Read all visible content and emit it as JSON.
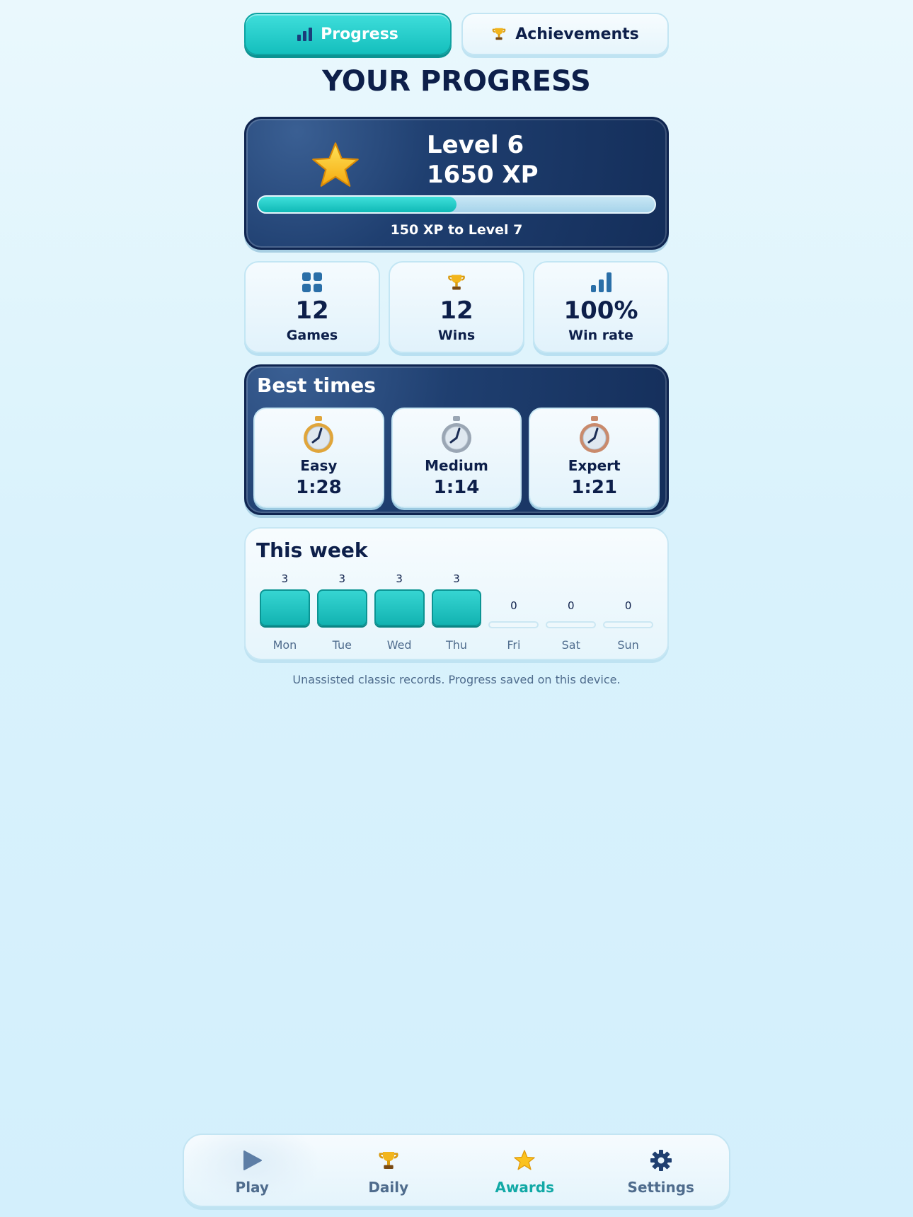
{
  "tabs": [
    {
      "label": "Progress",
      "icon": "bar-chart-icon",
      "active": true
    },
    {
      "label": "Achievements",
      "icon": "trophy-icon",
      "active": false
    }
  ],
  "page_title": "YOUR PROGRESS",
  "level": {
    "level_label": "Level 6",
    "xp_label": "1650 XP",
    "progress_fraction": 0.5,
    "next_label": "150 XP to Level 7"
  },
  "stats": [
    {
      "value": "12",
      "label": "Games",
      "icon": "grid-icon"
    },
    {
      "value": "12",
      "label": "Wins",
      "icon": "trophy-icon"
    },
    {
      "value": "100%",
      "label": "Win rate",
      "icon": "bar-chart-icon"
    }
  ],
  "best_times": {
    "title": "Best times",
    "items": [
      {
        "difficulty": "Easy",
        "time": "1:28",
        "medal_color": "#e0a53a"
      },
      {
        "difficulty": "Medium",
        "time": "1:14",
        "medal_color": "#9aa6b4"
      },
      {
        "difficulty": "Expert",
        "time": "1:21",
        "medal_color": "#c98a6c"
      }
    ]
  },
  "week": {
    "title": "This week",
    "days": [
      {
        "name": "Mon",
        "count": "3"
      },
      {
        "name": "Tue",
        "count": "3"
      },
      {
        "name": "Wed",
        "count": "3"
      },
      {
        "name": "Thu",
        "count": "3"
      },
      {
        "name": "Fri",
        "count": "0"
      },
      {
        "name": "Sat",
        "count": "0"
      },
      {
        "name": "Sun",
        "count": "0"
      }
    ]
  },
  "footer_note": "Unassisted classic records. Progress saved on this device.",
  "nav": [
    {
      "label": "Play",
      "icon": "play-icon",
      "active": false
    },
    {
      "label": "Daily",
      "icon": "trophy-icon",
      "active": false
    },
    {
      "label": "Awards",
      "icon": "star-icon",
      "active": true
    },
    {
      "label": "Settings",
      "icon": "gear-icon",
      "active": false
    }
  ],
  "colors": {
    "accent_teal": "#14bfbd",
    "navy": "#0d1f4a",
    "card_navy": "#1f3f70",
    "muted_text": "#4f6c8d"
  }
}
